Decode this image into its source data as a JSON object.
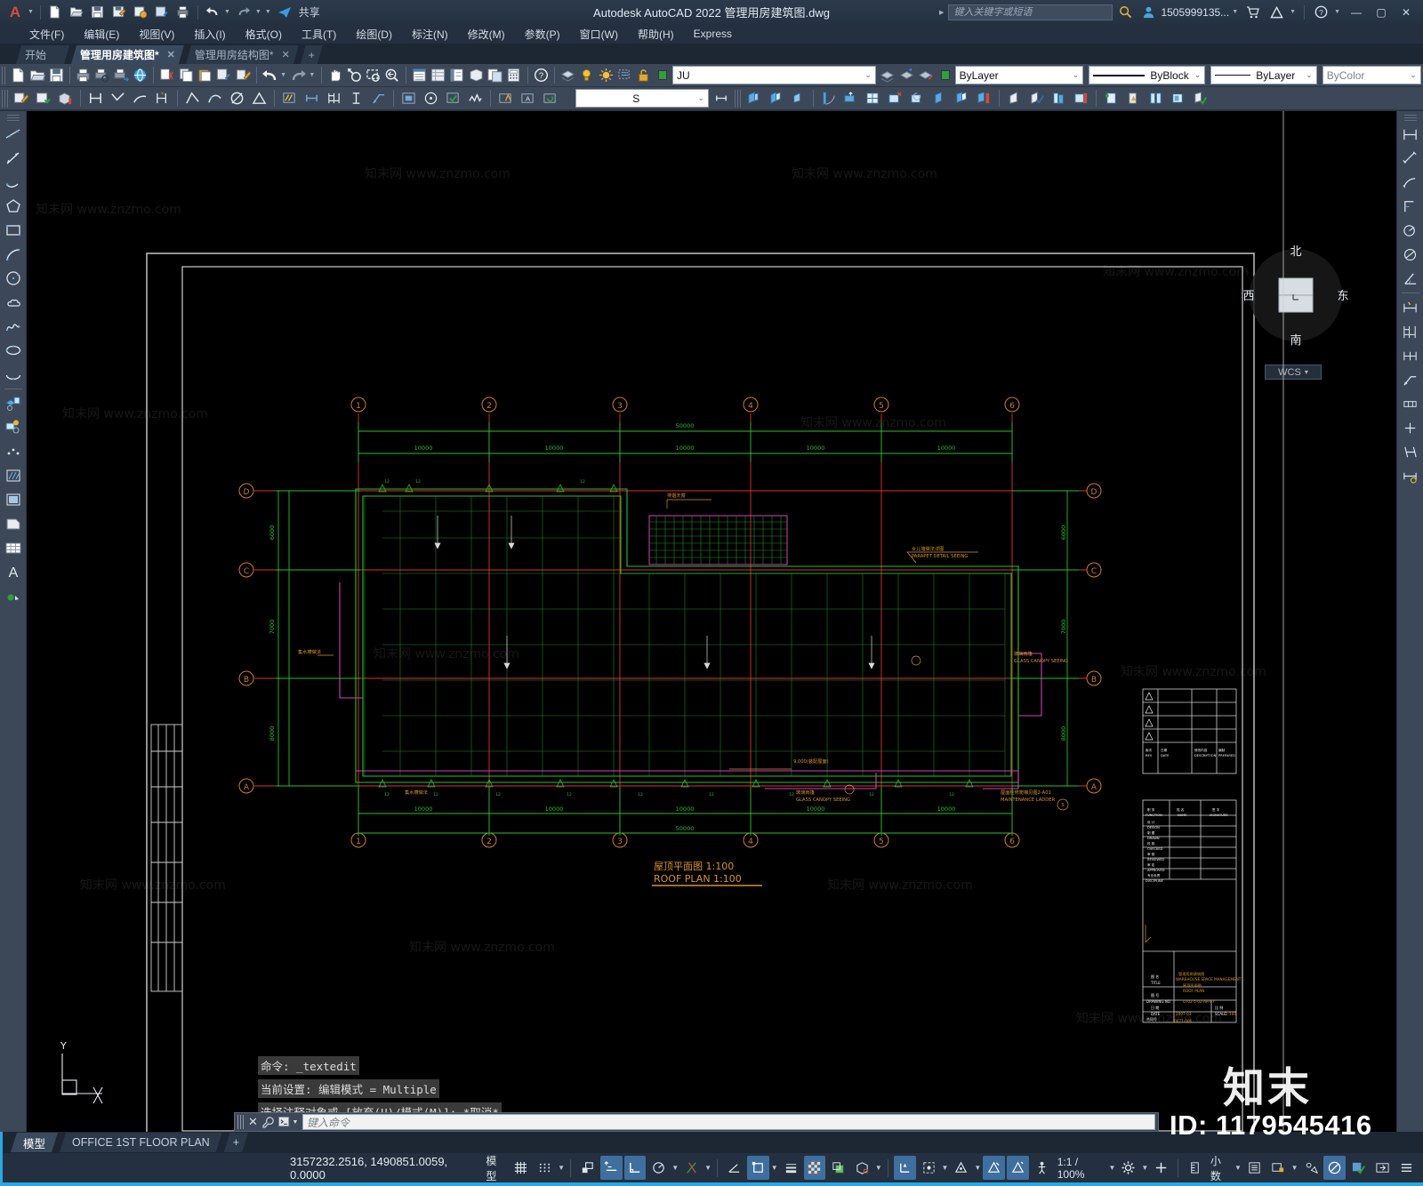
{
  "titlebar": {
    "app_title": "Autodesk AutoCAD 2022    管理用房建筑图.dwg",
    "share_label": "共享",
    "search_placeholder": "键入关键字或短语",
    "account": "1505999135...",
    "quick_access_icons": [
      "new-file-icon",
      "open-file-icon",
      "save-icon",
      "save-as-icon",
      "cloud-save-icon",
      "publish-icon",
      "plot-icon",
      "undo-icon",
      "redo-icon",
      "customize-icon",
      "share-icon"
    ],
    "window_buttons": [
      "minimize-icon",
      "maximize-icon",
      "close-icon"
    ]
  },
  "menubar": {
    "items": [
      "文件(F)",
      "编辑(E)",
      "视图(V)",
      "插入(I)",
      "格式(O)",
      "工具(T)",
      "绘图(D)",
      "标注(N)",
      "修改(M)",
      "参数(P)",
      "窗口(W)",
      "帮助(H)",
      "Express"
    ]
  },
  "filetabs": {
    "items": [
      {
        "label": "开始",
        "active": false,
        "closable": false
      },
      {
        "label": "管理用房建筑图*",
        "active": true,
        "closable": true
      },
      {
        "label": "管理用房结构图*",
        "active": false,
        "closable": true
      }
    ],
    "add_label": "+"
  },
  "toolbar_row1": {
    "layer_name": "JU",
    "layer_color": "#22aa33",
    "color_control": "ByLayer",
    "color_swatch": "#2f9e41",
    "linetype_control": "ByBlock",
    "lineweight_control": "ByLayer",
    "transparency_control": "ByColor",
    "icons": [
      "new-icon",
      "open-icon",
      "save-icon",
      "plot-icon",
      "preview-icon",
      "plot-to-file-icon",
      "web-icon",
      "cut-icon",
      "copy-icon",
      "paste-icon",
      "match-prop-icon",
      "erase-block-icon",
      "undo-icon",
      "redo-icon",
      "pan-icon",
      "zoom-realtime-icon",
      "zoom-window-icon",
      "zoom-previous-icon",
      "properties-icon",
      "designcenter-icon",
      "tool-palettes-icon",
      "blockpalette-icon",
      "sheetset-icon",
      "calculator-icon",
      "help-icon",
      "layer-properties-icon",
      "layer-on-icon",
      "layer-freeze-icon",
      "layer-iso-icon",
      "layer-lock-icon"
    ]
  },
  "toolbar_row2": {
    "text_style": "S",
    "icons": [
      "quick-calc-icon",
      "edit-attrib-icon",
      "block-attrib-icon",
      "line-icon",
      "polyline-icon",
      "arc-icon",
      "construction-line-icon",
      "spline-icon",
      "ellipse-icon",
      "circle-icon",
      "polygon-icon",
      "hatch-icon",
      "table-icon",
      "multiline-icon",
      "dim-linear-icon",
      "dim-aligned-icon",
      "insert-block-icon",
      "point-icon",
      "region-icon",
      "revcloud-icon",
      "mtext-icon",
      "text-icon",
      "update-icon",
      "door-icon",
      "window-icon",
      "wall-icon",
      "stair-icon",
      "column-icon",
      "railing-icon",
      "roof-icon",
      "balcony-icon",
      "furniture-icon",
      "dimension-tool-icon",
      "symbol-icon",
      "axis-icon",
      "detail-icon",
      "check-icon"
    ]
  },
  "left_toolbar": {
    "icons": [
      "construction-line-icon",
      "line-icon",
      "ray-icon",
      "polyline-icon",
      "polygon-icon",
      "rectangle-icon",
      "arc-icon",
      "circle-icon",
      "revision-cloud-icon",
      "spline-icon",
      "ellipse-icon",
      "ellipse-arc-icon",
      "insert-block-icon",
      "make-block-icon",
      "point-icon",
      "hatch-icon",
      "gradient-icon",
      "region-icon",
      "table-icon",
      "mtext-icon",
      "multiline-point-icon"
    ]
  },
  "right_toolbar": {
    "icons": [
      "dim-linear-icon",
      "dim-aligned-icon",
      "dim-arc-icon",
      "dim-ordinate-icon",
      "dim-radius-icon",
      "dim-diameter-icon",
      "dim-angular-icon",
      "quick-dim-icon",
      "dim-baseline-icon",
      "dim-continue-icon",
      "leader-icon",
      "tolerance-icon",
      "center-mark-icon",
      "dim-oblique-icon",
      "dim-style-icon"
    ]
  },
  "canvas": {
    "compass": {
      "north": "北",
      "south": "南",
      "east": "东",
      "west": "西"
    },
    "wcs_label": "WCS",
    "ucs_icon_label": "Y"
  },
  "drawing": {
    "plan_title_cn": "屋顶平面图",
    "plan_title_en": "ROOF PLAN",
    "plan_scale_cn": "1:100",
    "plan_scale_en": "1:100",
    "grid_labels_top": [
      "1",
      "2",
      "3",
      "4",
      "5",
      "6"
    ],
    "grid_labels_bottom": [
      "1",
      "2",
      "3",
      "4",
      "5",
      "6"
    ],
    "grid_labels_left": [
      "D",
      "C",
      "B",
      "A"
    ],
    "grid_labels_right": [
      "D",
      "C",
      "B",
      "A"
    ],
    "dim_top_row1": [
      "10000",
      "10000",
      "10000",
      "10000",
      "10000"
    ],
    "dim_top_total": "50000",
    "dim_bottom_row1": [
      "10000",
      "10000",
      "10000",
      "10000",
      "10000"
    ],
    "dim_bottom_total": "50000",
    "dim_left": [
      "6000",
      "7000",
      "8000"
    ],
    "dim_right": [
      "6000",
      "7000",
      "8000"
    ],
    "elevation_label": "9.000(装配屋面)",
    "annotations": [
      {
        "cn": "女儿墙做法详图",
        "en": "PARAPET DETAIL SEEING"
      },
      {
        "cn": "玻璃雨篷",
        "en": "GLASS CANOPY SEEING"
      },
      {
        "cn": "玻璃雨篷",
        "en": "GLASS CANOPY SEEING"
      },
      {
        "cn": "屋面检修爬梯",
        "en": "MAINTENANCE LADDER"
      },
      {
        "cn": "排烟天窗"
      },
      {
        "cn": "采光天窗"
      },
      {
        "cn": "屋面排水"
      }
    ],
    "titleblock": {
      "rev_cn": "版次",
      "rev_en": "REV",
      "date_cn": "日期",
      "date_en": "DATE",
      "desc_cn": "修改内容",
      "desc_en": "DESCRIPTION",
      "prep_cn": "编制",
      "prep_en": "PREPARED",
      "function_cn": "职 务",
      "function_en": "FUNCTION",
      "name_cn": "姓 名",
      "name_en": "NAME",
      "sign_cn": "签 字",
      "sign_en": "SIGNATURE",
      "rows": [
        "设 计 / DESIGN",
        "制 图 / DRAWN",
        "校 核 / CHECKED",
        "审 核 / REVIEWED",
        "审 定 / APPROVED",
        "专业负责 / DISCIPLINE"
      ],
      "title_cn": "图 名",
      "title_en": "TITLE",
      "title_value_cn": "管理用房建筑图",
      "title_value_en": "WAREHOUSE SPACE MANAGEMENT",
      "title_value2_cn": "屋顶平面图",
      "title_value2_en": "ROOF PLAN",
      "dwgno_cn": "图 号",
      "dwgno_en": "DRAWING NO",
      "dwgno_value": "0702-5-02-AR-07",
      "date_row_cn": "日 期",
      "date_row_en": "DATE",
      "date_value": "2007-03",
      "scale_cn": "比 例",
      "scale_en": "SCALE",
      "scale_value": "1:100",
      "contract_cn": "合同号",
      "contract_en": "CONT. NO",
      "contract_value": "0077-006"
    }
  },
  "command_window": {
    "history": [
      "命令: _textedit",
      "当前设置: 编辑模式 = Multiple",
      "选择注释对象或 [放弃(U)/模式(M)]: *取消*"
    ],
    "input_placeholder": "键入命令"
  },
  "statusbar": {
    "layout_tabs": [
      {
        "label": "模型",
        "selected": true
      },
      {
        "label": "OFFICE 1ST FLOOR PLAN",
        "selected": false
      },
      {
        "label": "+",
        "selected": false
      }
    ],
    "coordinates": "3157232.2516, 1490851.0059, 0.0000",
    "model_label": "模型",
    "scale_label": "1:1 / 100%",
    "units_label": "小数",
    "watermark_id": "ID: 1179545416",
    "icons": [
      "grid-icon",
      "snap-icon",
      "infer-constraints-icon",
      "dynamic-input-icon",
      "ortho-icon",
      "polar-tracking-icon",
      "osnap-icon",
      "otrack-icon",
      "3dosnap-icon",
      "lineweight-icon",
      "transparency-icon",
      "selection-cycling-icon",
      "3dobject-snap-icon",
      "dynamic-ucs-icon",
      "selection-filter-icon",
      "gizmo-icon",
      "annotation-visibility-icon",
      "autoscale-icon",
      "annotation-scale-icon",
      "workspace-icon",
      "customization-icon",
      "hardware-accel-icon",
      "isolate-objects-icon",
      "clean-screen-icon",
      "menu-icon"
    ]
  },
  "watermarks": {
    "text": "知末网 www.znzmo.com",
    "logo_cn": "知末",
    "id": "ID: 1179545416"
  }
}
